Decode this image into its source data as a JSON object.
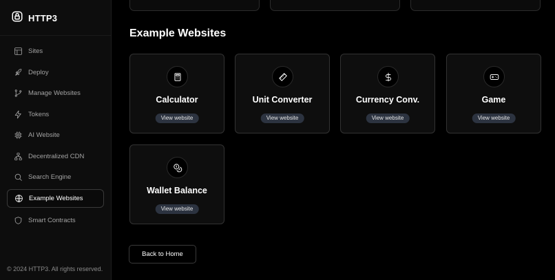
{
  "brand": {
    "title": "HTTP3",
    "icon": "lock-icon"
  },
  "sidebar": {
    "items": [
      {
        "label": "Sites",
        "icon": "layout-icon"
      },
      {
        "label": "Deploy",
        "icon": "rocket-icon"
      },
      {
        "label": "Manage Websites",
        "icon": "git-branch-icon"
      },
      {
        "label": "Tokens",
        "icon": "lightning-icon"
      },
      {
        "label": "AI Website",
        "icon": "chip-icon"
      },
      {
        "label": "Decentralized CDN",
        "icon": "network-icon"
      },
      {
        "label": "Search Engine",
        "icon": "search-icon"
      },
      {
        "label": "Example Websites",
        "icon": "globe-icon",
        "active": true
      },
      {
        "label": "Smart Contracts",
        "icon": "shield-icon"
      }
    ],
    "copyright": "© 2024 HTTP3. All rights reserved."
  },
  "main": {
    "title": "Example Websites",
    "cards": [
      {
        "title": "Calculator",
        "icon": "calculator-icon",
        "button": "View website"
      },
      {
        "title": "Unit Converter",
        "icon": "ruler-icon",
        "button": "View website"
      },
      {
        "title": "Currency Conv.",
        "icon": "dollar-icon",
        "button": "View website"
      },
      {
        "title": "Game",
        "icon": "gamepad-icon",
        "button": "View website"
      },
      {
        "title": "Wallet Balance",
        "icon": "coins-icon",
        "button": "View website"
      }
    ],
    "back_button": "Back to Home"
  }
}
